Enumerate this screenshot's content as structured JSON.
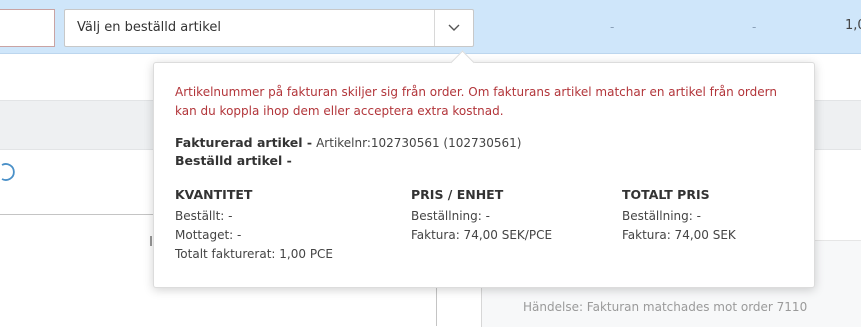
{
  "row": {
    "select_value": "Välj en beställd artikel",
    "dash_1": "-",
    "dash_2": "-",
    "amount": "1,0"
  },
  "background": {
    "event_text": "Händelse: Fakturan matchades mot order 7110"
  },
  "popover": {
    "warning": "Artikelnummer på fakturan skiljer sig från order. Om fakturans artikel matchar en artikel från ordern kan du koppla ihop dem eller acceptera extra kostnad.",
    "invoiced_label": "Fakturerad artikel -",
    "invoiced_value": "Artikelnr:102730561 (102730561)",
    "ordered_label": "Beställd artikel -",
    "quantity": {
      "heading": "KVANTITET",
      "lines": [
        "Beställt: -",
        "Mottaget: -",
        "Totalt fakturerat: 1,00 PCE"
      ]
    },
    "unit_price": {
      "heading": "PRIS / ENHET",
      "lines": [
        "Beställning: -",
        "Faktura: 74,00 SEK/PCE"
      ]
    },
    "total_price": {
      "heading": "TOTALT PRIS",
      "lines": [
        "Beställning: -",
        "Faktura: 74,00 SEK"
      ]
    }
  },
  "icons": {
    "dropdown": "chevron-down-icon",
    "loading": "refresh-icon"
  },
  "colors": {
    "row_highlight": "#cfe6fa",
    "warning_text": "#b2353a"
  }
}
